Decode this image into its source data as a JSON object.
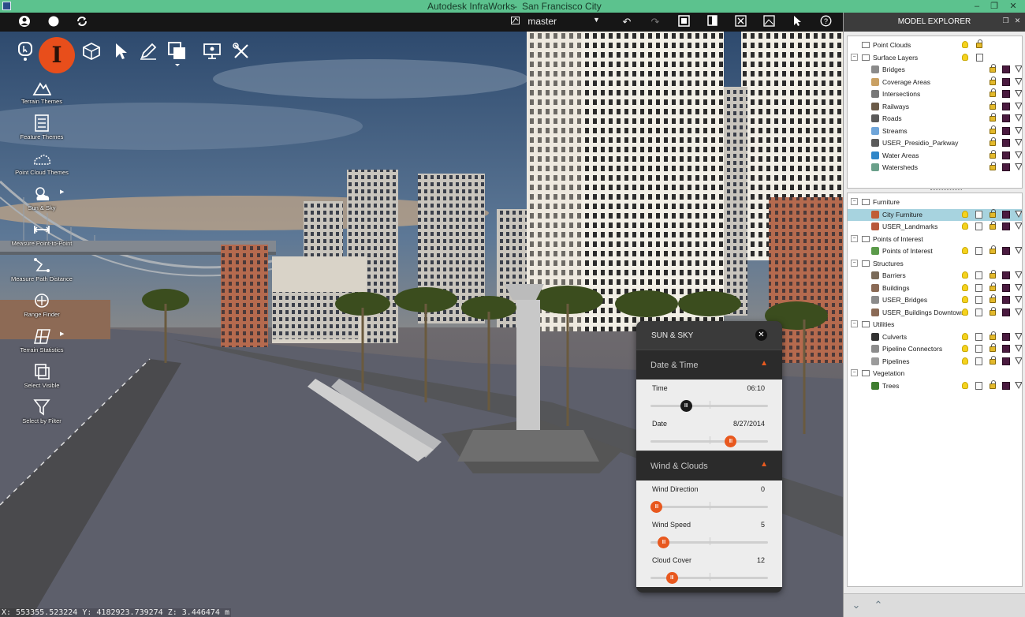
{
  "window": {
    "app_title": "Autodesk InfraWorks",
    "model_title": "San Francisco City"
  },
  "toolbar": {
    "proposal": "master",
    "left_icons": [
      "user-icon",
      "circle-icon",
      "sync-icon"
    ],
    "right_icons": [
      "undo-icon",
      "redo-icon",
      "windows-icon",
      "panel-icon",
      "fit-view-icon",
      "image-icon",
      "pointer-icon",
      "help-icon"
    ],
    "help": "?"
  },
  "main_toolbar": {
    "logo": "I",
    "icons": [
      "create-manage-icon",
      "build-icon",
      "select-pointer-icon",
      "sketch-pencil-icon",
      "layers-icon",
      "present-icon",
      "settings-tools-icon"
    ]
  },
  "tools": [
    {
      "label": "Terrain Themes",
      "icon": "mountain-icon"
    },
    {
      "label": "Feature Themes",
      "icon": "list-icon"
    },
    {
      "label": "Point Cloud Themes",
      "icon": "cloud-icon"
    },
    {
      "label": "Sun & Sky",
      "icon": "sun-cloud-icon"
    },
    {
      "label": "Measure Point-to-Point",
      "icon": "measure-icon"
    },
    {
      "label": "Measure Path Distance",
      "icon": "path-icon"
    },
    {
      "label": "Range Finder",
      "icon": "crosshair-icon"
    },
    {
      "label": "Terrain Statistics",
      "icon": "grid-icon"
    },
    {
      "label": "Select Visible",
      "icon": "select-icon"
    },
    {
      "label": "Select by Filter",
      "icon": "filter-icon"
    }
  ],
  "status": {
    "coordinates": "X: 553355.523224 Y: 4182923.739274 Z: 3.446474 m"
  },
  "sun_sky": {
    "title": "SUN & SKY",
    "date_time_section": "Date & Time",
    "wind_section": "Wind & Clouds",
    "sliders": [
      {
        "name": "Time",
        "value": "06:10",
        "position": 0.3
      },
      {
        "name": "Date",
        "value": "8/27/2014",
        "position": 0.68
      },
      {
        "name": "Wind Direction",
        "value": "0",
        "position": 0.05
      },
      {
        "name": "Wind Speed",
        "value": "5",
        "position": 0.11
      },
      {
        "name": "Cloud Cover",
        "value": "12",
        "position": 0.18
      }
    ]
  },
  "explorer": {
    "title": "MODEL EXPLORER",
    "top_items": [
      {
        "label": "Point Clouds",
        "level": 0,
        "icon": "folder",
        "expander": "",
        "controls": [
          "bulb",
          "lock"
        ]
      },
      {
        "label": "Surface Layers",
        "level": 0,
        "icon": "folder",
        "expander": "−",
        "controls": [
          "bulb",
          "book"
        ]
      },
      {
        "label": "Bridges",
        "level": 1,
        "icon": "bridge-icon",
        "expander": "",
        "controls": [
          "lock",
          "swatch",
          "filter"
        ]
      },
      {
        "label": "Coverage Areas",
        "level": 1,
        "icon": "coverage-icon",
        "expander": "",
        "controls": [
          "lock",
          "swatch",
          "filter"
        ]
      },
      {
        "label": "Intersections",
        "level": 1,
        "icon": "intersection-icon",
        "expander": "",
        "controls": [
          "lock",
          "swatch",
          "filter"
        ]
      },
      {
        "label": "Railways",
        "level": 1,
        "icon": "railway-icon",
        "expander": "",
        "controls": [
          "lock",
          "swatch",
          "filter"
        ]
      },
      {
        "label": "Roads",
        "level": 1,
        "icon": "road-icon",
        "expander": "",
        "controls": [
          "lock",
          "swatch",
          "filter"
        ]
      },
      {
        "label": "Streams",
        "level": 1,
        "icon": "stream-icon",
        "expander": "",
        "controls": [
          "lock",
          "swatch",
          "filter"
        ]
      },
      {
        "label": "USER_Presidio_Parkway",
        "level": 1,
        "icon": "road-icon",
        "expander": "",
        "controls": [
          "lock",
          "swatch",
          "filter"
        ]
      },
      {
        "label": "Water Areas",
        "level": 1,
        "icon": "water-icon",
        "expander": "",
        "controls": [
          "lock",
          "swatch",
          "filter"
        ]
      },
      {
        "label": "Watersheds",
        "level": 1,
        "icon": "watershed-icon",
        "expander": "",
        "controls": [
          "lock",
          "swatch",
          "filter"
        ]
      }
    ],
    "bottom_items": [
      {
        "label": "Furniture",
        "level": 0,
        "icon": "folder",
        "expander": "−",
        "controls": []
      },
      {
        "label": "City Furniture",
        "level": 1,
        "icon": "furniture-icon",
        "expander": "",
        "selected": true,
        "controls": [
          "bulb",
          "book",
          "lock",
          "swatch",
          "filter"
        ]
      },
      {
        "label": "USER_Landmarks",
        "level": 1,
        "icon": "landmark-icon",
        "expander": "",
        "controls": [
          "bulb",
          "book",
          "lock",
          "swatch",
          "filter"
        ]
      },
      {
        "label": "Points of Interest",
        "level": 0,
        "icon": "folder",
        "expander": "−",
        "controls": []
      },
      {
        "label": "Points of Interest",
        "level": 1,
        "icon": "poi-icon",
        "expander": "",
        "controls": [
          "bulb",
          "book",
          "lock",
          "swatch",
          "filter"
        ]
      },
      {
        "label": "Structures",
        "level": 0,
        "icon": "folder",
        "expander": "−",
        "controls": []
      },
      {
        "label": "Barriers",
        "level": 1,
        "icon": "barrier-icon",
        "expander": "",
        "controls": [
          "bulb",
          "book",
          "lock",
          "swatch",
          "filter"
        ]
      },
      {
        "label": "Buildings",
        "level": 1,
        "icon": "building-icon",
        "expander": "",
        "controls": [
          "bulb",
          "book",
          "lock",
          "swatch",
          "filter"
        ]
      },
      {
        "label": "USER_Bridges",
        "level": 1,
        "icon": "bridge-icon",
        "expander": "",
        "controls": [
          "bulb",
          "book",
          "lock",
          "swatch",
          "filter"
        ]
      },
      {
        "label": "USER_Buildings Downtown",
        "level": 1,
        "icon": "building-icon",
        "expander": "",
        "controls": [
          "bulb",
          "book",
          "lock",
          "swatch",
          "filter"
        ]
      },
      {
        "label": "Utilities",
        "level": 0,
        "icon": "folder",
        "expander": "−",
        "controls": []
      },
      {
        "label": "Culverts",
        "level": 1,
        "icon": "culvert-icon",
        "expander": "",
        "controls": [
          "bulb",
          "book",
          "lock",
          "swatch",
          "filter"
        ]
      },
      {
        "label": "Pipeline Connectors",
        "level": 1,
        "icon": "pipe-connector-icon",
        "expander": "",
        "controls": [
          "bulb",
          "book",
          "lock",
          "swatch",
          "filter"
        ]
      },
      {
        "label": "Pipelines",
        "level": 1,
        "icon": "pipeline-icon",
        "expander": "",
        "controls": [
          "bulb",
          "book",
          "lock",
          "swatch",
          "filter"
        ]
      },
      {
        "label": "Vegetation",
        "level": 0,
        "icon": "folder",
        "expander": "−",
        "controls": []
      },
      {
        "label": "Trees",
        "level": 1,
        "icon": "tree-icon",
        "expander": "",
        "controls": [
          "bulb",
          "book",
          "lock",
          "swatch",
          "filter"
        ]
      }
    ]
  },
  "colors": {
    "titlebar": "#5cc28e",
    "accent": "#e84e1b",
    "selection": "#a7d3df",
    "swatch": "#4a1a3f"
  }
}
